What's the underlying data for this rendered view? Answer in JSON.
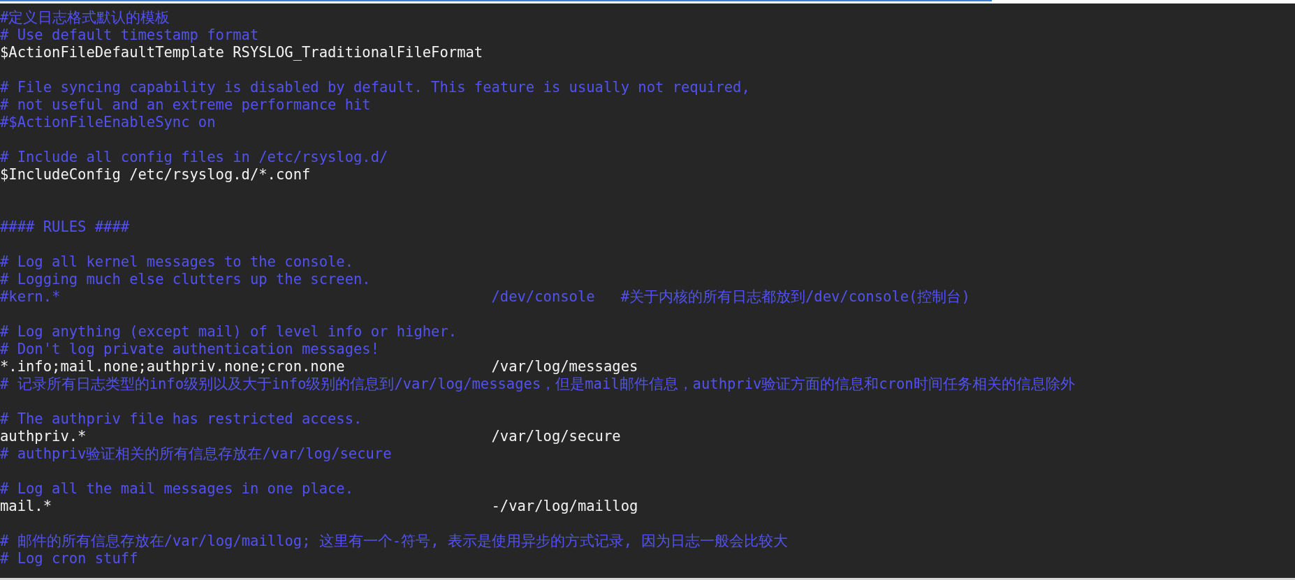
{
  "editor": {
    "lines": [
      {
        "kind": "comment",
        "text": "#定义日志格式默认的模板"
      },
      {
        "kind": "comment",
        "text": "# Use default timestamp format"
      },
      {
        "kind": "code",
        "text": "$ActionFileDefaultTemplate RSYSLOG_TraditionalFileFormat"
      },
      {
        "kind": "blank"
      },
      {
        "kind": "comment",
        "text": "# File syncing capability is disabled by default. This feature is usually not required,"
      },
      {
        "kind": "comment",
        "text": "# not useful and an extreme performance hit"
      },
      {
        "kind": "comment",
        "text": "#$ActionFileEnableSync on"
      },
      {
        "kind": "blank"
      },
      {
        "kind": "comment",
        "text": "# Include all config files in /etc/rsyslog.d/"
      },
      {
        "kind": "code",
        "text": "$IncludeConfig /etc/rsyslog.d/*.conf"
      },
      {
        "kind": "blank"
      },
      {
        "kind": "blank"
      },
      {
        "kind": "comment",
        "text": "#### RULES ####"
      },
      {
        "kind": "blank"
      },
      {
        "kind": "comment",
        "text": "# Log all kernel messages to the console."
      },
      {
        "kind": "comment",
        "text": "# Logging much else clutters up the screen."
      },
      {
        "kind": "comment",
        "text": "#kern.*                                                  /dev/console   #关于内核的所有日志都放到/dev/console(控制台)"
      },
      {
        "kind": "blank"
      },
      {
        "kind": "comment",
        "text": "# Log anything (except mail) of level info or higher."
      },
      {
        "kind": "comment",
        "text": "# Don't log private authentication messages!"
      },
      {
        "kind": "code",
        "text": "*.info;mail.none;authpriv.none;cron.none                 /var/log/messages"
      },
      {
        "kind": "comment",
        "text": "# 记录所有日志类型的info级别以及大于info级别的信息到/var/log/messages，但是mail邮件信息，authpriv验证方面的信息和cron时间任务相关的信息除外"
      },
      {
        "kind": "blank"
      },
      {
        "kind": "comment",
        "text": "# The authpriv file has restricted access."
      },
      {
        "kind": "code",
        "text": "authpriv.*                                               /var/log/secure"
      },
      {
        "kind": "comment",
        "text": "# authpriv验证相关的所有信息存放在/var/log/secure"
      },
      {
        "kind": "blank"
      },
      {
        "kind": "comment",
        "text": "# Log all the mail messages in one place."
      },
      {
        "kind": "code",
        "text": "mail.*                                                   -/var/log/maillog"
      },
      {
        "kind": "blank"
      },
      {
        "kind": "comment",
        "text": "# 邮件的所有信息存放在/var/log/maillog; 这里有一个-符号, 表示是使用异步的方式记录, 因为日志一般会比较大"
      },
      {
        "kind": "comment",
        "text": "# Log cron stuff"
      }
    ]
  }
}
